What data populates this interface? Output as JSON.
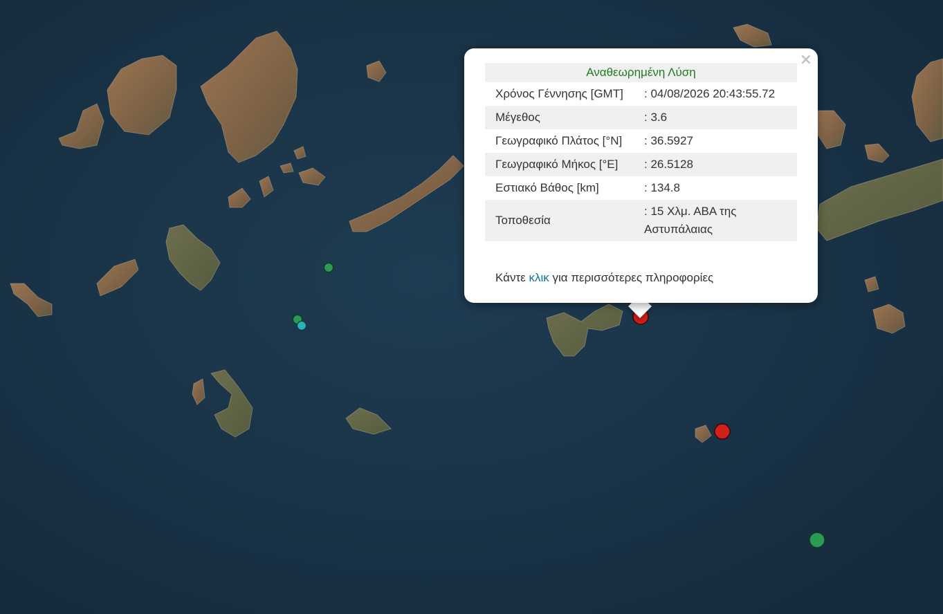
{
  "popup": {
    "title": "Αναθεωρημένη Λύση",
    "close": "×",
    "rows": [
      {
        "label": "Χρόνος Γέννησης [GMT]",
        "value": ": 04/08/2026 20:43:55.72"
      },
      {
        "label": "Μέγεθος",
        "value": ": 3.6"
      },
      {
        "label": "Γεωγραφικό Πλάτος [°N]",
        "value": ": 36.5927"
      },
      {
        "label": "Γεωγραφικό Μήκος [°E]",
        "value": ": 26.5128"
      },
      {
        "label": "Εστιακό Βάθος [km]",
        "value": ": 134.8"
      },
      {
        "label": "Τοποθεσία",
        "value": ": 15 Χλμ. ΑΒΑ της Αστυπάλαιας"
      }
    ],
    "more_prefix": "Κάντε ",
    "more_link": "κλικ",
    "more_suffix": " για περισσότερες πληροφορίες"
  },
  "markers": [
    {
      "id": "selected-event",
      "color": "#d0201a"
    },
    {
      "id": "event-2",
      "color": "#d0201a"
    },
    {
      "id": "event-3",
      "color": "#2a9a55"
    },
    {
      "id": "event-4",
      "color": "#2a9a55"
    },
    {
      "id": "event-5",
      "color": "#2a9a55"
    },
    {
      "id": "event-6",
      "color": "#27b3b8"
    }
  ],
  "colors": {
    "sea": "#1a3347",
    "land": "#8a6a4c",
    "header_text": "#1e7b1e",
    "link": "#0b72a6"
  }
}
